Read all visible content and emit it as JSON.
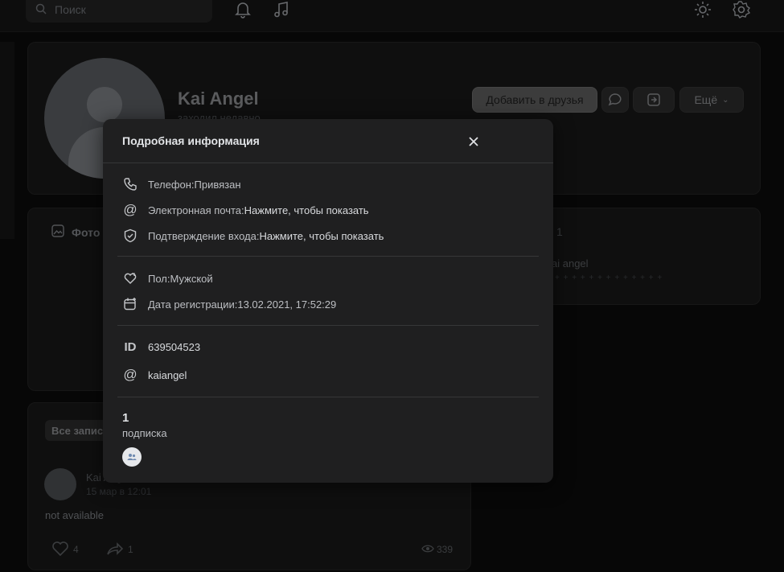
{
  "topbar": {
    "search_placeholder": "Поиск",
    "icons": [
      "search-icon",
      "bell-icon",
      "music-icon",
      "sun-icon",
      "gear-icon"
    ]
  },
  "profile": {
    "name": "Kai Angel",
    "status": "заходил недавно",
    "add_friend_label": "Добавить в друзья",
    "more_label": "Ещё"
  },
  "photos": {
    "label": "Фото"
  },
  "friends_panel": {
    "count": "1",
    "name": "ai angel",
    "dots": "+ + + + + + + + + + + + +"
  },
  "wall": {
    "tab_label": "Все записи",
    "post_author": "Kai Angel",
    "post_date": "15 мар в 12:01",
    "post_text": "not available",
    "likes": "4",
    "shares": "1",
    "views": "339"
  },
  "modal": {
    "title": "Подробная информация",
    "rows": [
      {
        "icon": "phone-icon",
        "key": "Телефон: ",
        "value": "Привязан"
      },
      {
        "icon": "at-icon",
        "key": "Электронная почта: ",
        "value": "Нажмите, чтобы показать"
      },
      {
        "icon": "shield-icon",
        "key": "Подтверждение входа: ",
        "value": "Нажмите, чтобы показать"
      },
      {
        "icon": "gender-icon",
        "key": "Пол: ",
        "value": "Мужской"
      },
      {
        "icon": "calendar-icon",
        "key": "Дата регистрации: ",
        "value": "13.02.2021, 17:52:29"
      },
      {
        "icon": "id-icon",
        "key": "ID",
        "value": "639504523"
      },
      {
        "icon": "at-icon",
        "key": "@",
        "value": "kaiangel"
      }
    ],
    "subscriptions_count": "1",
    "subscriptions_label": "подписка"
  },
  "colors": {
    "background": "#0b0b0b",
    "modal": "#1f1f20",
    "card": "#171717"
  }
}
